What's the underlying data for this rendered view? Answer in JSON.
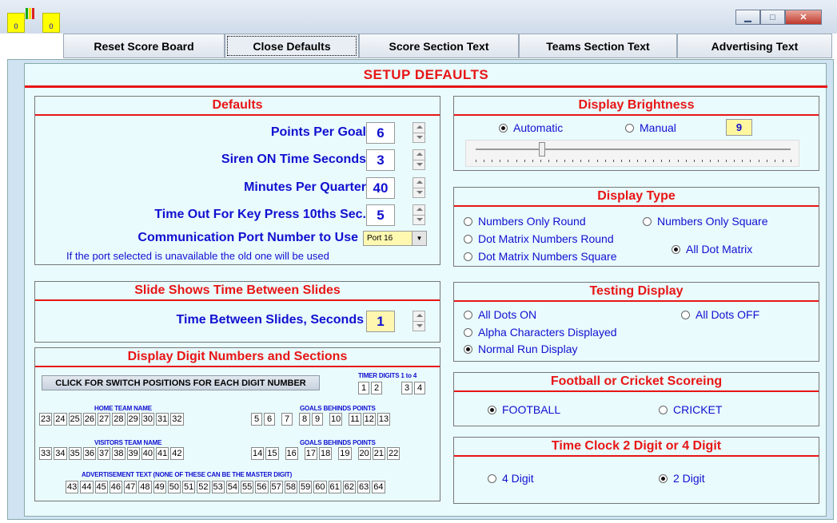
{
  "corner_boxes": [
    "0",
    "0"
  ],
  "tabs": [
    "Reset Score Board",
    "Close Defaults",
    "Score Section Text",
    "Teams Section Text",
    "Advertising Text"
  ],
  "title": "SETUP DEFAULTS",
  "defaults": {
    "header": "Defaults",
    "points_label": "Points Per Goal",
    "points_value": "6",
    "siren_label": "Siren ON Time Seconds",
    "siren_value": "3",
    "minutes_label": "Minutes Per Quarter",
    "minutes_value": "40",
    "timeout_label": "Time Out For Key Press 10ths Sec.",
    "timeout_value": "5",
    "port_label": "Communication Port Number to Use",
    "port_value": "Port 16",
    "port_note": "If the port selected is unavailable the old one will be used"
  },
  "slides": {
    "header": "Slide Shows Time Between Slides",
    "label": "Time Between Slides, Seconds",
    "value": "1"
  },
  "digits": {
    "header": "Display Digit Numbers and Sections",
    "switch_button": "CLICK FOR SWITCH POSITIONS FOR EACH DIGIT NUMBER",
    "timer_label": "TIMER DIGITS 1 to 4",
    "timer_a": [
      "1",
      "2"
    ],
    "timer_b": [
      "3",
      "4"
    ],
    "home_label": "HOME TEAM NAME",
    "goals_label_1": "GOALS BEHINDS POINTS",
    "home_cells": [
      "23",
      "24",
      "25",
      "26",
      "27",
      "28",
      "29",
      "30",
      "31",
      "32"
    ],
    "home_g": [
      "5",
      "6"
    ],
    "home_b": [
      "7"
    ],
    "home_c": [
      "8",
      "9"
    ],
    "home_d": [
      "10"
    ],
    "home_e": [
      "11",
      "12",
      "13"
    ],
    "visitors_label": "VISITORS TEAM NAME",
    "goals_label_2": "GOALS BEHINDS POINTS",
    "vis_cells": [
      "33",
      "34",
      "35",
      "36",
      "37",
      "38",
      "39",
      "40",
      "41",
      "42"
    ],
    "vis_g": [
      "14",
      "15"
    ],
    "vis_b": [
      "16"
    ],
    "vis_c": [
      "17",
      "18"
    ],
    "vis_d": [
      "19"
    ],
    "vis_e": [
      "20",
      "21",
      "22"
    ],
    "adv_label": "ADVERTISEMENT TEXT (NONE OF THESE CAN BE THE MASTER DIGIT)",
    "adv_cells": [
      "43",
      "44",
      "45",
      "46",
      "47",
      "48",
      "49",
      "50",
      "51",
      "52",
      "53",
      "54",
      "55",
      "56",
      "57",
      "58",
      "59",
      "60",
      "61",
      "62",
      "63",
      "64"
    ]
  },
  "brightness": {
    "header": "Display Brightness",
    "auto": "Automatic",
    "manual": "Manual",
    "value": "9",
    "slider_level": 0.21
  },
  "display_type": {
    "header": "Display Type",
    "opt1": "Numbers Only Round",
    "opt2": "Numbers Only Square",
    "opt3": "Dot Matrix Numbers Round",
    "opt4": "Dot Matrix Numbers Square",
    "opt5": "All Dot Matrix"
  },
  "testing": {
    "header": "Testing Display",
    "opt1": "All Dots ON",
    "opt2": "All Dots OFF",
    "opt3": "Alpha Characters Displayed",
    "opt4": "Normal Run Display"
  },
  "sport": {
    "header": "Football or Cricket Scoreing",
    "opt1": "FOOTBALL",
    "opt2": "CRICKET"
  },
  "clock": {
    "header": "Time Clock 2 Digit or 4 Digit",
    "opt1": "4 Digit",
    "opt2": "2 Digit"
  }
}
